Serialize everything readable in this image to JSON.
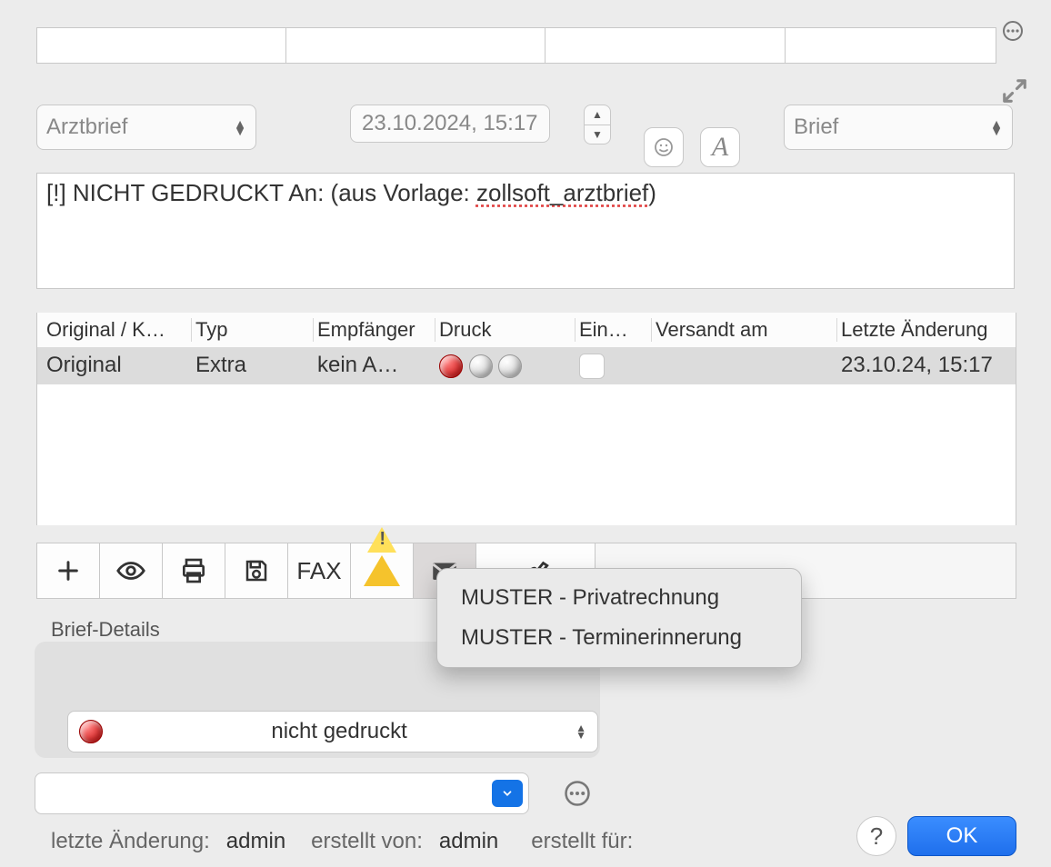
{
  "top": {
    "type_select": "Arztbrief",
    "datetime": "23.10.2024, 15:17",
    "kind_select": "Brief"
  },
  "textarea": {
    "prefix": "[!] NICHT GEDRUCKT An:   (aus Vorlage: ",
    "template_name": "zollsoft_arztbrief",
    "suffix": ")"
  },
  "table": {
    "headers": [
      "Original / K…",
      "Typ",
      "Empfänger",
      "Druck",
      "Ein…",
      "Versandt am",
      "Letzte Änderung"
    ],
    "row": {
      "original": "Original",
      "typ": "Extra",
      "empf": "kein A…",
      "versandt": "",
      "letzte": "23.10.24, 15:17"
    }
  },
  "toolbar": {
    "fax_label": "FAX"
  },
  "popup": {
    "items": [
      "MUSTER - Privatrechnung",
      "MUSTER - Terminerinnerung"
    ]
  },
  "details": {
    "title": "Brief-Details",
    "status": "nicht gedruckt"
  },
  "meta": {
    "last_change_label": "letzte Änderung:",
    "last_change_user": "admin",
    "created_by_label": "erstellt von:",
    "created_by_user": "admin",
    "created_for_label": "erstellt für:"
  },
  "buttons": {
    "ok": "OK",
    "help": "?"
  }
}
